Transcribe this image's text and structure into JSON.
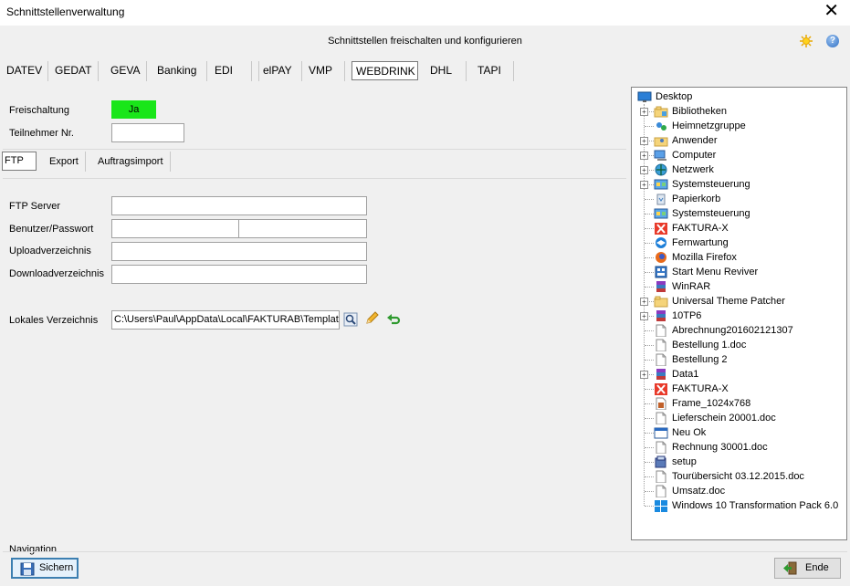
{
  "window": {
    "title": "Schnittstellenverwaltung",
    "close_glyph": "✕"
  },
  "header": {
    "text": "Schnittstellen freischalten und konfigurieren",
    "help_glyph": "?",
    "icons": [
      "sun-icon",
      "help-icon"
    ]
  },
  "main_tabs": [
    "DATEV",
    "GEDAT",
    "GEVA",
    "Banking",
    "EDI",
    "elPAY",
    "VMP",
    "WEBDRINK",
    "DHL",
    "TAPI"
  ],
  "main_tab_active": "WEBDRINK",
  "form": {
    "freischaltung_label": "Freischaltung",
    "freischaltung_value": "Ja",
    "teilnehmer_label": "Teilnehmer Nr.",
    "teilnehmer_value": ""
  },
  "sub_tabs": [
    "FTP",
    "Export",
    "Auftragsimport"
  ],
  "sub_tab_active": "FTP",
  "ftp": {
    "server_label": "FTP Server",
    "user_label": "Benutzer/Passwort",
    "upload_label": "Uploadverzeichnis",
    "download_label": "Downloadverzeichnis",
    "local_label": "Lokales Verzeichnis",
    "local_value": "C:\\Users\\Paul\\AppData\\Local\\FAKTURAB\\Templates\\"
  },
  "tree": {
    "root": "Desktop",
    "items": [
      {
        "label": "Bibliotheken",
        "icon": "library-icon",
        "expandable": true
      },
      {
        "label": "Heimnetzgruppe",
        "icon": "homegroup-icon",
        "expandable": false
      },
      {
        "label": "Anwender",
        "icon": "user-folder-icon",
        "expandable": true
      },
      {
        "label": "Computer",
        "icon": "computer-icon",
        "expandable": true
      },
      {
        "label": "Netzwerk",
        "icon": "network-icon",
        "expandable": true
      },
      {
        "label": "Systemsteuerung",
        "icon": "control-panel-icon",
        "expandable": true
      },
      {
        "label": "Papierkorb",
        "icon": "recycle-bin-icon",
        "expandable": false
      },
      {
        "label": "Systemsteuerung",
        "icon": "control-panel-icon",
        "expandable": false
      },
      {
        "label": "FAKTURA-X",
        "icon": "faktura-icon",
        "expandable": false
      },
      {
        "label": "Fernwartung",
        "icon": "teamviewer-icon",
        "expandable": false
      },
      {
        "label": "Mozilla Firefox",
        "icon": "firefox-icon",
        "expandable": false
      },
      {
        "label": "Start Menu Reviver",
        "icon": "app-icon",
        "expandable": false
      },
      {
        "label": "WinRAR",
        "icon": "winrar-icon",
        "expandable": false
      },
      {
        "label": "Universal Theme Patcher",
        "icon": "folder-icon",
        "expandable": true
      },
      {
        "label": "10TP6",
        "icon": "winrar-icon",
        "expandable": true
      },
      {
        "label": "Abrechnung201602121307",
        "icon": "file-icon",
        "expandable": false
      },
      {
        "label": "Bestellung 1.doc",
        "icon": "file-icon",
        "expandable": false
      },
      {
        "label": "Bestellung 2",
        "icon": "file-icon",
        "expandable": false
      },
      {
        "label": "Data1",
        "icon": "winrar-icon",
        "expandable": true
      },
      {
        "label": "FAKTURA-X",
        "icon": "faktura-icon",
        "expandable": false
      },
      {
        "label": "Frame_1024x768",
        "icon": "image-file-icon",
        "expandable": false
      },
      {
        "label": "Lieferschein 20001.doc",
        "icon": "file-icon",
        "expandable": false
      },
      {
        "label": "Neu Ok",
        "icon": "window-file-icon",
        "expandable": false
      },
      {
        "label": "Rechnung 30001.doc",
        "icon": "file-icon",
        "expandable": false
      },
      {
        "label": "setup",
        "icon": "setup-icon",
        "expandable": false
      },
      {
        "label": "Tourübersicht 03.12.2015.doc",
        "icon": "file-icon",
        "expandable": false
      },
      {
        "label": "Umsatz.doc",
        "icon": "file-icon",
        "expandable": false
      },
      {
        "label": "Windows 10 Transformation Pack 6.0",
        "icon": "windows-icon",
        "expandable": false
      }
    ]
  },
  "navigation": {
    "label": "Navigation",
    "save_label": "Sichern",
    "end_label": "Ende"
  },
  "colors": {
    "ja_green": "#19e619",
    "focus_blue": "#3c7fb1"
  }
}
